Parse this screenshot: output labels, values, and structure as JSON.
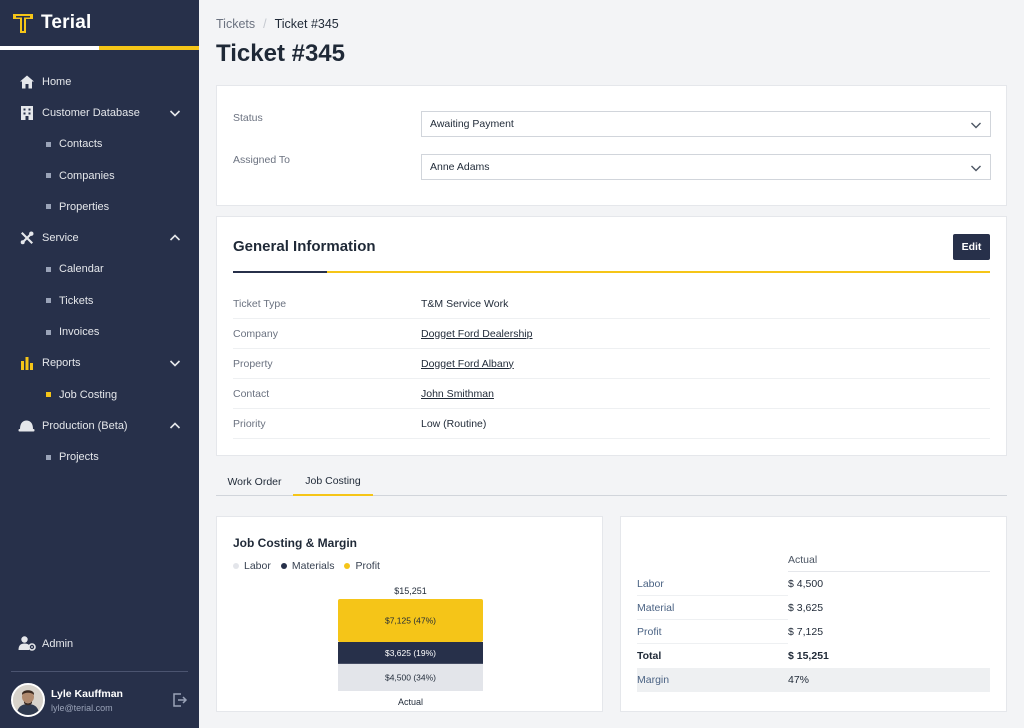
{
  "brand": {
    "name": "Terial"
  },
  "sidebar": {
    "items": [
      {
        "label": "Home"
      },
      {
        "label": "Customer Database",
        "children": [
          "Contacts",
          "Companies",
          "Properties"
        ]
      },
      {
        "label": "Service",
        "children": [
          "Calendar",
          "Tickets",
          "Invoices"
        ]
      },
      {
        "label": "Reports",
        "children": [
          "Job Costing"
        ]
      },
      {
        "label": "Production (Beta)",
        "children": [
          "Projects"
        ]
      }
    ],
    "admin": "Admin",
    "user": {
      "name": "Lyle Kauffman",
      "email": "lyle@terial.com"
    }
  },
  "breadcrumb": {
    "parent": "Tickets",
    "separator": "/",
    "current": "Ticket #345"
  },
  "page": {
    "title": "Ticket #345"
  },
  "status_form": {
    "status_label": "Status",
    "status_value": "Awaiting Payment",
    "assigned_label": "Assigned To",
    "assigned_value": "Anne Adams"
  },
  "general": {
    "title": "General Information",
    "edit_label": "Edit",
    "rows": [
      {
        "label": "Ticket Type",
        "value": "T&M Service Work"
      },
      {
        "label": "Company",
        "value": "Dogget Ford Dealership"
      },
      {
        "label": "Property",
        "value": "Dogget Ford Albany"
      },
      {
        "label": "Contact",
        "value": "John Smithman"
      },
      {
        "label": "Priority",
        "value": "Low (Routine)"
      }
    ]
  },
  "tabs": [
    "Work Order",
    "Job Costing"
  ],
  "chart_data": {
    "type": "bar",
    "title": "Job Costing & Margin",
    "stacked": true,
    "categories": [
      "Actual"
    ],
    "total_label": "$15,251",
    "series": [
      {
        "name": "Labor",
        "values": [
          4500
        ],
        "label": "$4,500 (34%)",
        "color": "#e3e5ea"
      },
      {
        "name": "Materials",
        "values": [
          3625
        ],
        "label": "$3,625 (19%)",
        "color": "#27304a"
      },
      {
        "name": "Profit",
        "values": [
          7125
        ],
        "label": "$7,125 (47%)",
        "color": "#f5c518"
      }
    ],
    "legend": "top-left"
  },
  "costing_table": {
    "header": "Actual",
    "rows": [
      {
        "label": "Labor",
        "value": "$ 4,500"
      },
      {
        "label": "Material",
        "value": "$ 3,625"
      },
      {
        "label": "Profit",
        "value": "$ 7,125"
      },
      {
        "label": "Total",
        "value": "$ 15,251"
      },
      {
        "label": "Margin",
        "value": "47%"
      }
    ]
  },
  "colors": {
    "sidebar": "#27304a",
    "accent": "#f5c518",
    "link": "#4a6283"
  }
}
